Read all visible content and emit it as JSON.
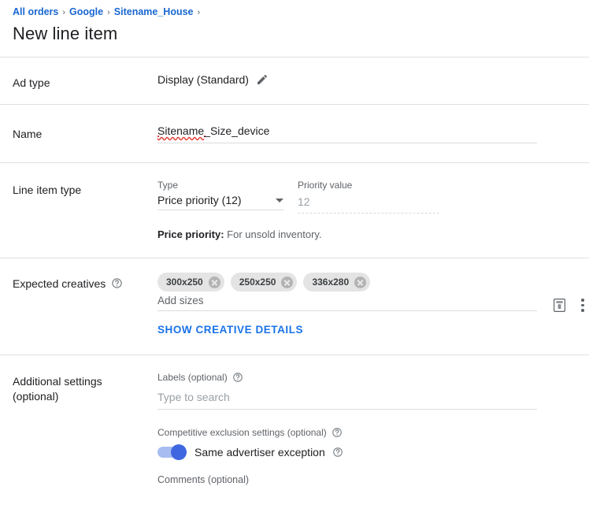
{
  "header": {
    "breadcrumb": [
      {
        "label": "All orders",
        "link": true
      },
      {
        "label": "Google",
        "link": true
      },
      {
        "label": "Sitename_House",
        "link": true
      }
    ],
    "separator": "›",
    "title": "New line item"
  },
  "ad_type": {
    "label": "Ad type",
    "value": "Display (Standard)",
    "edit_icon": "pencil-icon"
  },
  "name": {
    "label": "Name",
    "value": "Sitename_Size_device",
    "misspelled_part": "Sitename",
    "rest_part": "_Size_device"
  },
  "line_item_type": {
    "label": "Line item type",
    "type_field_label": "Type",
    "type_value": "Price priority (12)",
    "priority_field_label": "Priority value",
    "priority_value": "12",
    "hint_bold": "Price priority:",
    "hint_text": "For unsold inventory."
  },
  "expected_creatives": {
    "label": "Expected creatives",
    "help_icon": "help-icon",
    "chips": [
      "300x250",
      "250x250",
      "336x280"
    ],
    "add_sizes_placeholder": "Add sizes",
    "master_size_icon": "creative-template-icon",
    "overflow_icon": "kebab-menu-icon",
    "show_details_label": "Show creative details"
  },
  "additional_settings": {
    "label_line1": "Additional settings",
    "label_line2": "(optional)",
    "labels_field_label": "Labels (optional)",
    "labels_placeholder": "Type to search",
    "competitive_exclusion_label": "Competitive exclusion settings (optional)",
    "toggle_label": "Same advertiser exception",
    "toggle_on": true,
    "comments_label": "Comments (optional)"
  },
  "colors": {
    "link": "#1967d2",
    "action_link": "#1a73e8",
    "toggle_track": "#a7bdf2",
    "toggle_knob": "#3f68e0",
    "chip_bg": "#e4e4e4",
    "divider": "#e0e0e0",
    "muted_text": "#5f6368",
    "spellcheck": "#e53935"
  }
}
